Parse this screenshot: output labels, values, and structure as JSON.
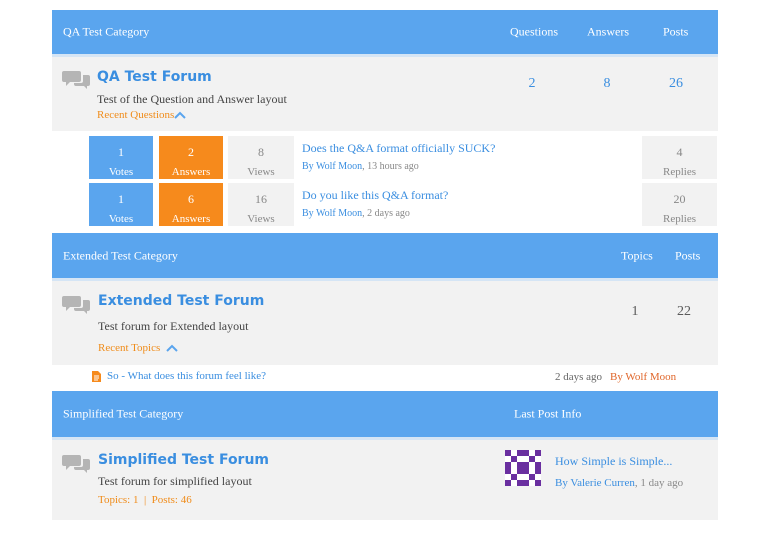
{
  "categories": {
    "qa": {
      "title": "QA Test Category",
      "col1": "Questions",
      "col2": "Answers",
      "col3": "Posts"
    },
    "extended": {
      "title": "Extended Test Category",
      "col1": "Topics",
      "col2": "Posts"
    },
    "simplified": {
      "title": "Simplified Test Category",
      "col1": "Last Post Info"
    }
  },
  "qa_forum": {
    "title": "QA Test Forum",
    "description": "Test of the Question and Answer layout",
    "recent_link": "Recent Questions",
    "questions": "2",
    "answers": "8",
    "posts": "26",
    "topics": [
      {
        "votes": "1",
        "votes_label": "Votes",
        "answers": "2",
        "answers_label": "Answers",
        "views": "8",
        "views_label": "Views",
        "title": "Does the Q&A format officially SUCK?",
        "by": "By Wolf Moon",
        "time": ", 13 hours ago",
        "replies": "4",
        "replies_label": "Replies"
      },
      {
        "votes": "1",
        "votes_label": "Votes",
        "answers": "6",
        "answers_label": "Answers",
        "views": "16",
        "views_label": "Views",
        "title": "Do you like this Q&A format?",
        "by": "By Wolf Moon",
        "time": ", 2 days ago",
        "replies": "20",
        "replies_label": "Replies"
      }
    ]
  },
  "extended_forum": {
    "title": "Extended Test Forum",
    "description": "Test forum for Extended layout",
    "recent_link": "Recent Topics",
    "topics": "1",
    "posts": "22",
    "recent": {
      "title": "So - What does this forum feel like?",
      "time": "2 days ago",
      "by": "By Wolf Moon"
    }
  },
  "simplified_forum": {
    "title": "Simplified Test Forum",
    "description": "Test forum for simplified layout",
    "stats": "Topics: 1  |  Posts: 46",
    "last_post_title": "How Simple is Simple...",
    "last_post_by": "By Valerie Curren",
    "last_post_time": ", 1 day ago"
  },
  "colors": {
    "header": "#5aa5ee",
    "accent_blue": "#3a8ee0",
    "accent_orange": "#f68a1c",
    "row_gray": "#f2f2f2"
  },
  "icons": {
    "forum": "chat-bubbles-icon",
    "collapse": "chevron-up-icon",
    "topic": "document-icon",
    "avatar": "identicon-avatar"
  }
}
